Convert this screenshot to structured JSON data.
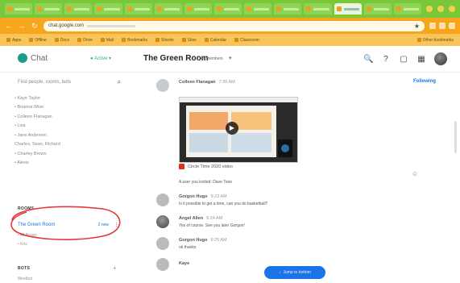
{
  "browser": {
    "tab_count": 14,
    "active_tab_index": 11,
    "nav": {
      "back": "←",
      "forward": "→",
      "reload": "↻"
    },
    "url": "chat.google.com",
    "url_star": "★",
    "bookmarks": [
      "Apps",
      "Offline",
      "Docs",
      "Drive",
      "Mail",
      "Bookmarks",
      "Sheets",
      "Sites",
      "Calendar",
      "Classroom"
    ],
    "bookmarks_right": "Other bookmarks"
  },
  "header": {
    "app_title": "Chat",
    "status": "● Active ▾",
    "room_title": "The Green Room",
    "room_members": "48 members",
    "room_chevron": "▾",
    "icons": {
      "search": "🔍",
      "help": "?",
      "feedback": "▢",
      "apps": "▦"
    }
  },
  "sidebar": {
    "search_placeholder": "Find people, rooms, bots",
    "search_icon": "⌕",
    "dms": [
      "• Kaye Taylor",
      "• Brianna Wise",
      "• Colleen Flanagan",
      "• Lisa",
      "• Jane Anderson",
      "Charles, Sean, Richard",
      "• Charley Brown",
      "• Alexis"
    ],
    "rooms_label": "ROOMS",
    "room_active": {
      "name": "The Green Room",
      "badge": "2 new",
      "more": "⋮"
    },
    "room_subs": [
      "• All Brown",
      "• Kris"
    ],
    "bots_label": "BOTS",
    "bots_add": "+",
    "bot_item": "Meetbot"
  },
  "messages": {
    "following": "Following",
    "items": [
      {
        "sender": "Colleen Flanagan",
        "time": "7:35 AM",
        "text": ""
      },
      {
        "sender": "",
        "time": "",
        "text": "A user you invited: Dave Tone"
      },
      {
        "sender": "Gorgon Hugo",
        "time": "9:23 AM",
        "text": "Is it possible to get a time, can you do basketball?"
      },
      {
        "sender": "Angel Allen",
        "time": "9:24 AM",
        "text": "Yes of course. See you later Gorgon!"
      },
      {
        "sender": "Gorgon Hugo",
        "time": "9:25 AM",
        "text": "ok thanks"
      },
      {
        "sender": "Kaye",
        "time": "",
        "text": ""
      }
    ],
    "attachment_name": "Circle Time 2020 video",
    "play_glyph": "▶",
    "emoji_icon": "☺",
    "jump_label": "Jump to bottom",
    "jump_arrow": "↓"
  },
  "colors": {
    "tabstrip": "#78c83a",
    "addrbar": "#f7a51c",
    "accent": "#1a73e8",
    "annotation": "#e03a3a"
  }
}
